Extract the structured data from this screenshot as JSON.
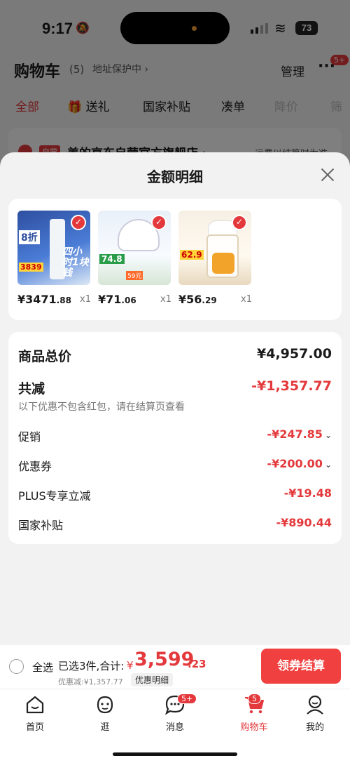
{
  "status": {
    "time": "9:17",
    "battery": "73"
  },
  "cart": {
    "title": "购物车",
    "count": "(5)",
    "address": "地址保护中 ›",
    "manage": "管理",
    "more_badge": "5+"
  },
  "tabs": [
    "全部",
    "送礼",
    "国家补贴",
    "凑单",
    "降价",
    "筛"
  ],
  "shop": {
    "tag": "自营",
    "name": "美的京东自营官方旗舰店 ›",
    "note": "运费以结算时为准"
  },
  "sheet": {
    "title": "金额明细",
    "products": [
      {
        "price_main": "¥3471",
        "price_cents": ".88",
        "qty": "x1"
      },
      {
        "price_main": "¥71",
        "price_cents": ".06",
        "qty": "x1"
      },
      {
        "price_main": "¥56",
        "price_cents": ".29",
        "qty": "x1"
      }
    ],
    "product_images": [
      {
        "tag": "8折",
        "price": "3839",
        "text": "四小时1块钱"
      },
      {
        "tag": "74.8",
        "note": "59元"
      },
      {
        "tag": "62.9"
      }
    ],
    "total_label": "商品总价",
    "total_value": "¥4,957.00",
    "discount_label": "共减",
    "discount_value": "-¥1,357.77",
    "discount_note": "以下优惠不包含红包，请在结算页查看",
    "items": [
      {
        "label": "促销",
        "value": "-¥247.85",
        "expandable": true
      },
      {
        "label": "优惠券",
        "value": "-¥200.00",
        "expandable": true
      },
      {
        "label": "PLUS专享立减",
        "value": "-¥19.48",
        "expandable": false
      },
      {
        "label": "国家补贴",
        "value": "-¥890.44",
        "expandable": false
      }
    ]
  },
  "checkout": {
    "select_all": "全选",
    "selected_info": "已选3件,合计:",
    "currency": "¥",
    "total_main": "3,599",
    "total_cents": ".23",
    "discount_line": "优惠减:¥1,357.77",
    "detail_chip": "优惠明细",
    "button": "领券结算"
  },
  "tabbar": [
    {
      "label": "首页",
      "icon": "home-icon",
      "badge": ""
    },
    {
      "label": "逛",
      "icon": "browse-face-icon",
      "badge": ""
    },
    {
      "label": "消息",
      "icon": "message-icon",
      "badge": "5+"
    },
    {
      "label": "购物车",
      "icon": "cart-icon",
      "badge": "5"
    },
    {
      "label": "我的",
      "icon": "profile-icon",
      "badge": ""
    }
  ],
  "colors": {
    "accent": "#e4393c",
    "button": "#f0403f"
  }
}
